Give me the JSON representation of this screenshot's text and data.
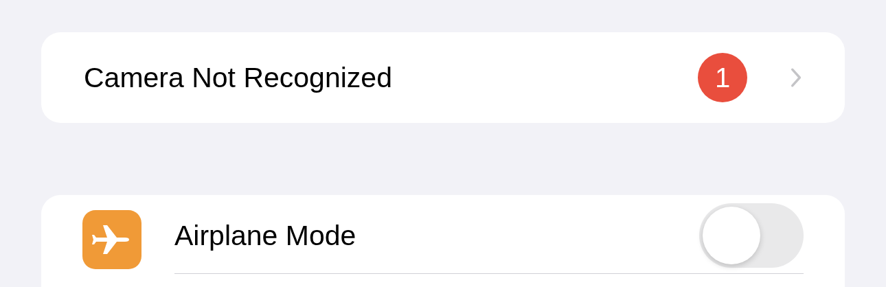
{
  "alerts": [
    {
      "label": "Camera Not Recognized",
      "badge": "1"
    }
  ],
  "settings": [
    {
      "label": "Airplane Mode",
      "kind": "toggle",
      "on": false
    }
  ]
}
